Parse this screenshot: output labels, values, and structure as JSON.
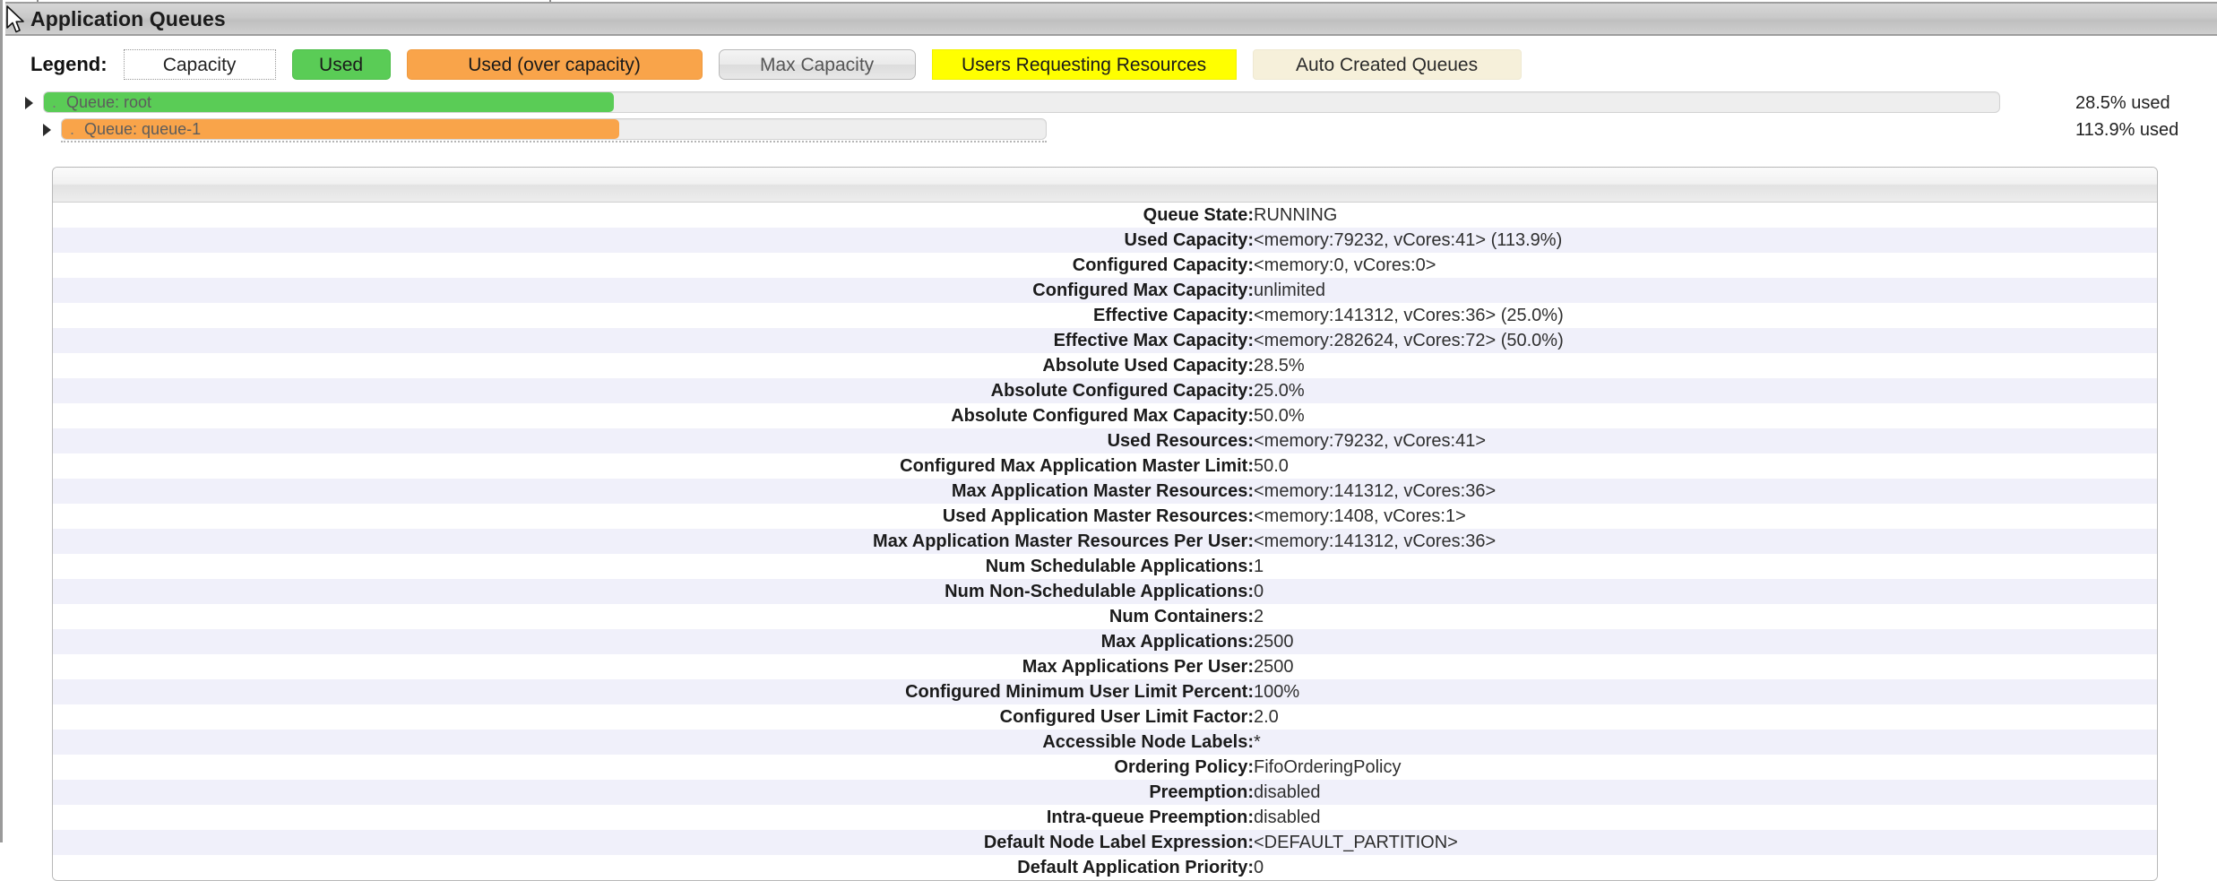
{
  "window": {
    "title": "Application Queues"
  },
  "legend": {
    "label": "Legend:",
    "items": [
      {
        "text": "Capacity",
        "style": "capacity"
      },
      {
        "text": "Used",
        "style": "used"
      },
      {
        "text": "Used (over capacity)",
        "style": "over"
      },
      {
        "text": "Max Capacity",
        "style": "maxcap"
      },
      {
        "text": "Users Requesting Resources",
        "style": "users"
      },
      {
        "text": "Auto Created Queues",
        "style": "auto"
      }
    ]
  },
  "queues": [
    {
      "name": "Queue: root",
      "dot": ".",
      "used_text": "28.5% used",
      "fill_color": "#5ACC56",
      "fill_percent": 28.5,
      "depth": 0
    },
    {
      "name": "Queue: queue-1",
      "dot": ".",
      "used_text": "113.9% used",
      "fill_color": "#F9A44A",
      "fill_percent": 113.9,
      "depth": 1
    }
  ],
  "detail": {
    "rows": [
      {
        "key": "Queue State:",
        "value": "RUNNING"
      },
      {
        "key": "Used Capacity:",
        "value": "<memory:79232, vCores:41> (113.9%)"
      },
      {
        "key": "Configured Capacity:",
        "value": "<memory:0, vCores:0>"
      },
      {
        "key": "Configured Max Capacity:",
        "value": "unlimited"
      },
      {
        "key": "Effective Capacity:",
        "value": "<memory:141312, vCores:36> (25.0%)"
      },
      {
        "key": "Effective Max Capacity:",
        "value": "<memory:282624, vCores:72> (50.0%)"
      },
      {
        "key": "Absolute Used Capacity:",
        "value": "28.5%"
      },
      {
        "key": "Absolute Configured Capacity:",
        "value": "25.0%"
      },
      {
        "key": "Absolute Configured Max Capacity:",
        "value": "50.0%"
      },
      {
        "key": "Used Resources:",
        "value": "<memory:79232, vCores:41>"
      },
      {
        "key": "Configured Max Application Master Limit:",
        "value": "50.0"
      },
      {
        "key": "Max Application Master Resources:",
        "value": "<memory:141312, vCores:36>"
      },
      {
        "key": "Used Application Master Resources:",
        "value": "<memory:1408, vCores:1>"
      },
      {
        "key": "Max Application Master Resources Per User:",
        "value": "<memory:141312, vCores:36>"
      },
      {
        "key": "Num Schedulable Applications:",
        "value": "1"
      },
      {
        "key": "Num Non-Schedulable Applications:",
        "value": "0"
      },
      {
        "key": "Num Containers:",
        "value": "2"
      },
      {
        "key": "Max Applications:",
        "value": "2500"
      },
      {
        "key": "Max Applications Per User:",
        "value": "2500"
      },
      {
        "key": "Configured Minimum User Limit Percent:",
        "value": "100%"
      },
      {
        "key": "Configured User Limit Factor:",
        "value": "2.0"
      },
      {
        "key": "Accessible Node Labels:",
        "value": "*"
      },
      {
        "key": "Ordering Policy:",
        "value": "FifoOrderingPolicy"
      },
      {
        "key": "Preemption:",
        "value": "disabled"
      },
      {
        "key": "Intra-queue Preemption:",
        "value": "disabled"
      },
      {
        "key": "Default Node Label Expression:",
        "value": "<DEFAULT_PARTITION>"
      },
      {
        "key": "Default Application Priority:",
        "value": "0"
      }
    ]
  },
  "colors": {
    "used_green": "#5ACC56",
    "over_orange": "#F9A44A",
    "users_yellow": "#FFFF00",
    "auto_cream": "#F6F0DA",
    "row_stripe": "#F0F0FA",
    "title_bar": "#c9c9c9"
  },
  "icons": {
    "cursor": "mouse-cursor",
    "expand_arrow": "triangle-right"
  }
}
